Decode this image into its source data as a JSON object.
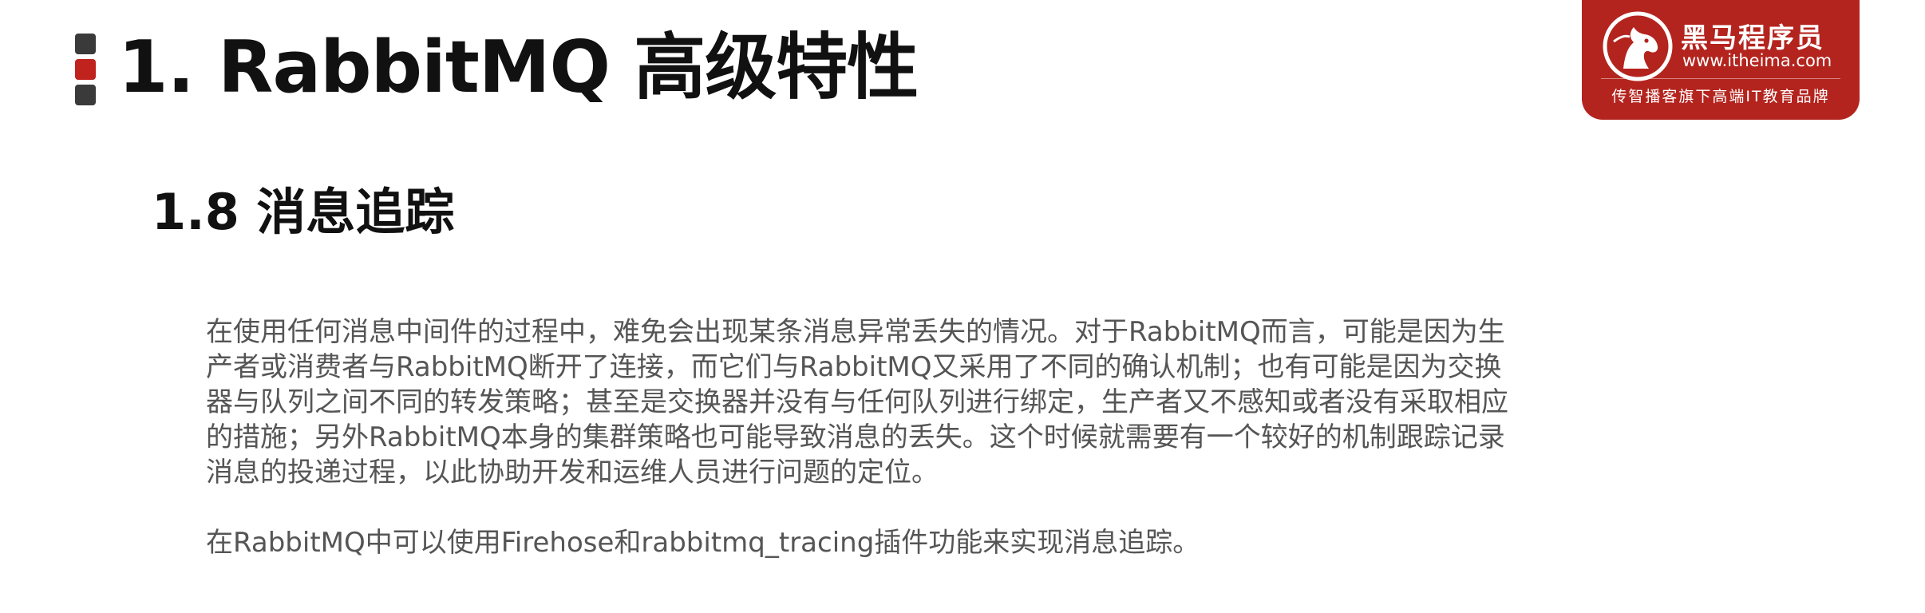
{
  "header": {
    "title": "1. RabbitMQ 高级特性",
    "bullet_colors": [
      "#3a3a3a",
      "#c0231e",
      "#3a3a3a"
    ]
  },
  "section": {
    "heading": "1.8 消息追踪"
  },
  "content": {
    "paragraph1": "在使用任何消息中间件的过程中，难免会出现某条消息异常丢失的情况。对于RabbitMQ而言，可能是因为生产者或消费者与RabbitMQ断开了连接，而它们与RabbitMQ又采用了不同的确认机制；也有可能是因为交换器与队列之间不同的转发策略；甚至是交换器并没有与任何队列进行绑定，生产者又不感知或者没有采取相应的措施；另外RabbitMQ本身的集群策略也可能导致消息的丢失。这个时候就需要有一个较好的机制跟踪记录消息的投递过程，以此协助开发和运维人员进行问题的定位。",
    "paragraph2": "在RabbitMQ中可以使用Firehose和rabbitmq_tracing插件功能来实现消息追踪。"
  },
  "logo": {
    "name": "黑马程序员",
    "url": "www.itheima.com",
    "slogan": "传智播客旗下高端IT教育品牌",
    "background_color": "#b4241e",
    "icon": "horse-head-logo-icon"
  }
}
